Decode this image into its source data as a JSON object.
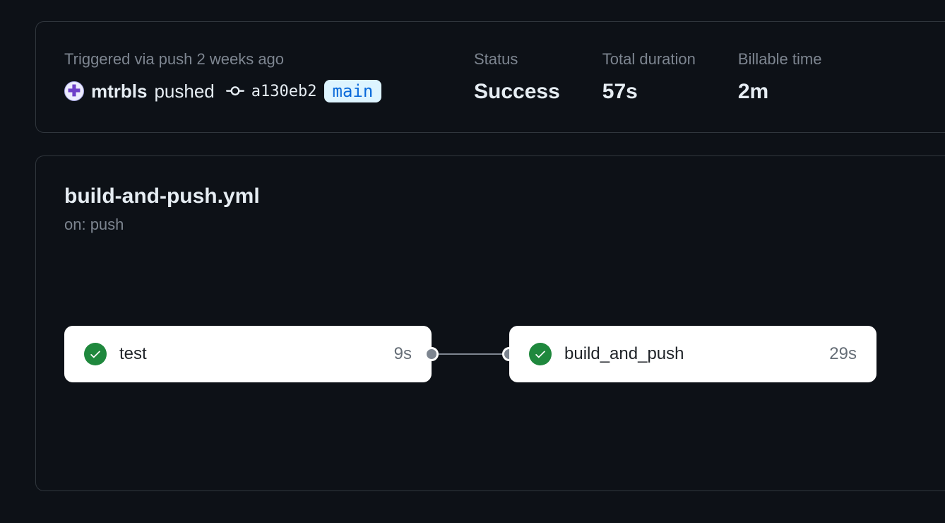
{
  "summary": {
    "trigger_label": "Triggered via push 2 weeks ago",
    "actor": "mtrbls",
    "action_text": "pushed",
    "commit_sha": "a130eb2",
    "branch": "main",
    "status_label": "Status",
    "status_value": "Success",
    "duration_label": "Total duration",
    "duration_value": "57s",
    "billable_label": "Billable time",
    "billable_value": "2m"
  },
  "workflow": {
    "filename": "build-and-push.yml",
    "trigger": "on: push",
    "jobs": [
      {
        "name": "test",
        "duration": "9s",
        "status": "success"
      },
      {
        "name": "build_and_push",
        "duration": "29s",
        "status": "success"
      }
    ]
  }
}
